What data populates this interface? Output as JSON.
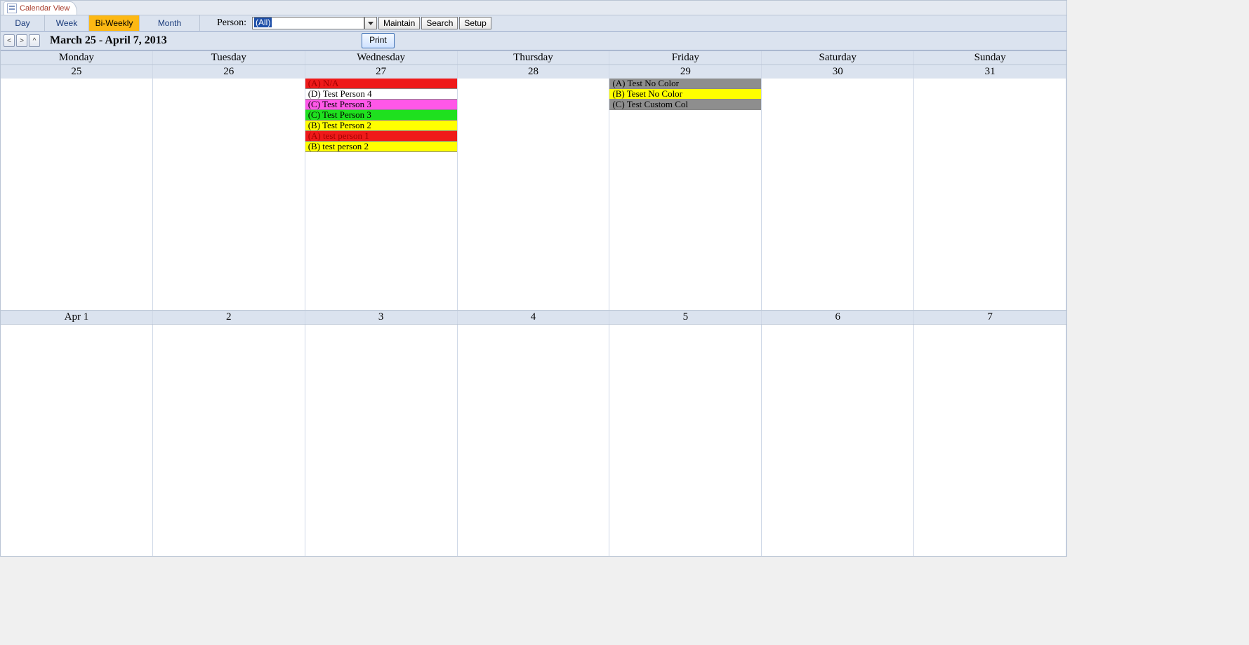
{
  "tab": {
    "title": "Calendar View"
  },
  "views": {
    "day": "Day",
    "week": "Week",
    "biweekly": "Bi-Weekly",
    "month": "Month"
  },
  "person": {
    "label": "Person:",
    "value": "(All)"
  },
  "actions": {
    "maintain": "Maintain",
    "search": "Search",
    "setup": "Setup",
    "print": "Print"
  },
  "nav": {
    "prev": "<",
    "next": ">",
    "up": "^"
  },
  "date_range": "March 25 - April 7, 2013",
  "dow": [
    "Monday",
    "Tuesday",
    "Wednesday",
    "Thursday",
    "Friday",
    "Saturday",
    "Sunday"
  ],
  "week1_dates": [
    "25",
    "26",
    "27",
    "28",
    "29",
    "30",
    "31"
  ],
  "week2_dates": [
    "Apr 1",
    "2",
    "3",
    "4",
    "5",
    "6",
    "7"
  ],
  "colors": {
    "red": "#ef1a1a",
    "white": "#ffffff",
    "magenta": "#ff57e8",
    "green": "#1fe01f",
    "yellow": "#ffff00",
    "gray": "#8e8e8e"
  },
  "week1_events": {
    "2": [
      {
        "label": "(A) N/A",
        "bg": "red",
        "fg": "#a00000"
      },
      {
        "label": "(D) Test Person 4",
        "bg": "white",
        "fg": "#000"
      },
      {
        "label": "(C) Test Person 3",
        "bg": "magenta",
        "fg": "#000"
      },
      {
        "label": "(C) Test Person 3",
        "bg": "green",
        "fg": "#000"
      },
      {
        "label": "(B) Test Person 2",
        "bg": "yellow",
        "fg": "#000"
      },
      {
        "label": "(A) test person 1",
        "bg": "red",
        "fg": "#a00000"
      },
      {
        "label": "(B) test person 2",
        "bg": "yellow",
        "fg": "#000"
      }
    ],
    "4": [
      {
        "label": "(A) Test No Color",
        "bg": "gray",
        "fg": "#000"
      },
      {
        "label": "(B) Teset No Color",
        "bg": "yellow",
        "fg": "#000"
      },
      {
        "label": "(C) Test Custom Col",
        "bg": "gray",
        "fg": "#000"
      }
    ]
  }
}
